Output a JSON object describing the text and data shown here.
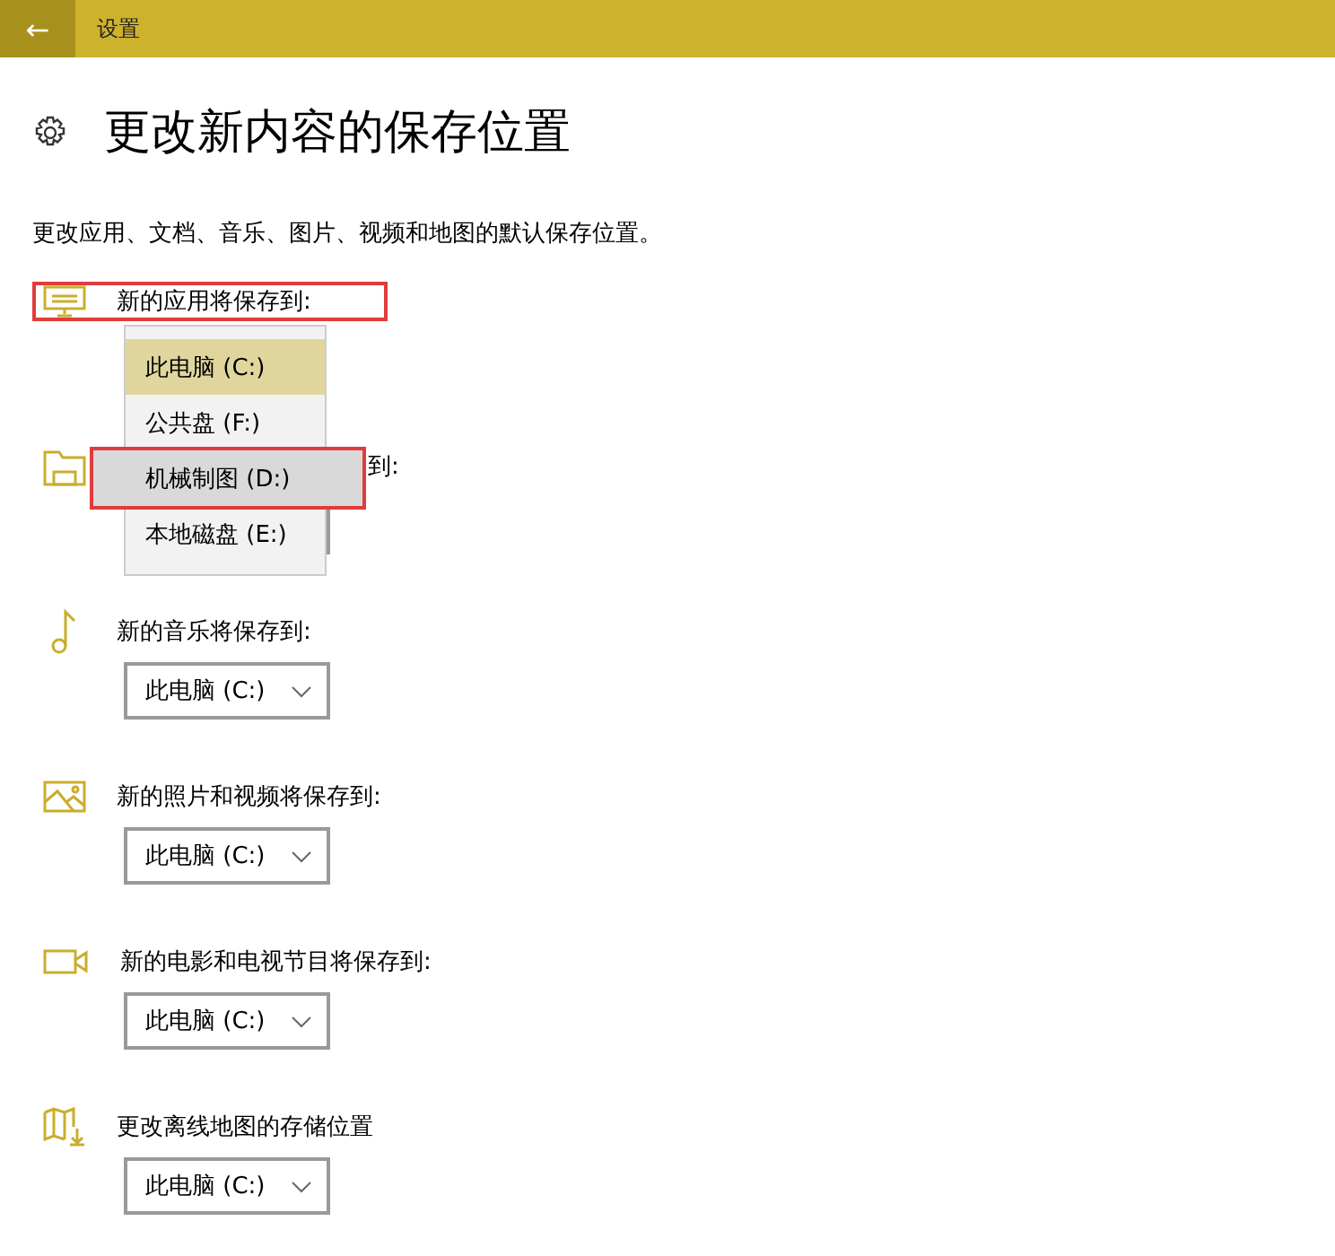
{
  "header": {
    "back": "←",
    "title": "设置"
  },
  "page": {
    "title": "更改新内容的保存位置",
    "description": "更改应用、文档、音乐、图片、视频和地图的默认保存位置。"
  },
  "sections": [
    {
      "kind": "apps",
      "label": "新的应用将保存到:",
      "highlighted": true,
      "open": true
    },
    {
      "kind": "documents",
      "label": "到:",
      "covered": true,
      "highlighted": false,
      "open": false
    },
    {
      "kind": "music",
      "label": "新的音乐将保存到:",
      "highlighted": false,
      "open": false,
      "value": "此电脑 (C:)"
    },
    {
      "kind": "photos",
      "label": "新的照片和视频将保存到:",
      "highlighted": false,
      "open": false,
      "value": "此电脑 (C:)"
    },
    {
      "kind": "movies",
      "label": "新的电影和电视节目将保存到:",
      "highlighted": false,
      "open": false,
      "value": "此电脑 (C:)"
    },
    {
      "kind": "maps",
      "label": "更改离线地图的存储位置",
      "highlighted": false,
      "open": false,
      "value": "此电脑 (C:)"
    }
  ],
  "dropdown_options": [
    {
      "label": "此电脑 (C:)",
      "selected": true,
      "hovered": false,
      "highlighted": false
    },
    {
      "label": "公共盘 (F:)",
      "selected": false,
      "hovered": false,
      "highlighted": false
    },
    {
      "label": "机械制图 (D:)",
      "selected": false,
      "hovered": true,
      "highlighted": true
    },
    {
      "label": "本地磁盘 (E:)",
      "selected": false,
      "hovered": false,
      "highlighted": false
    }
  ]
}
